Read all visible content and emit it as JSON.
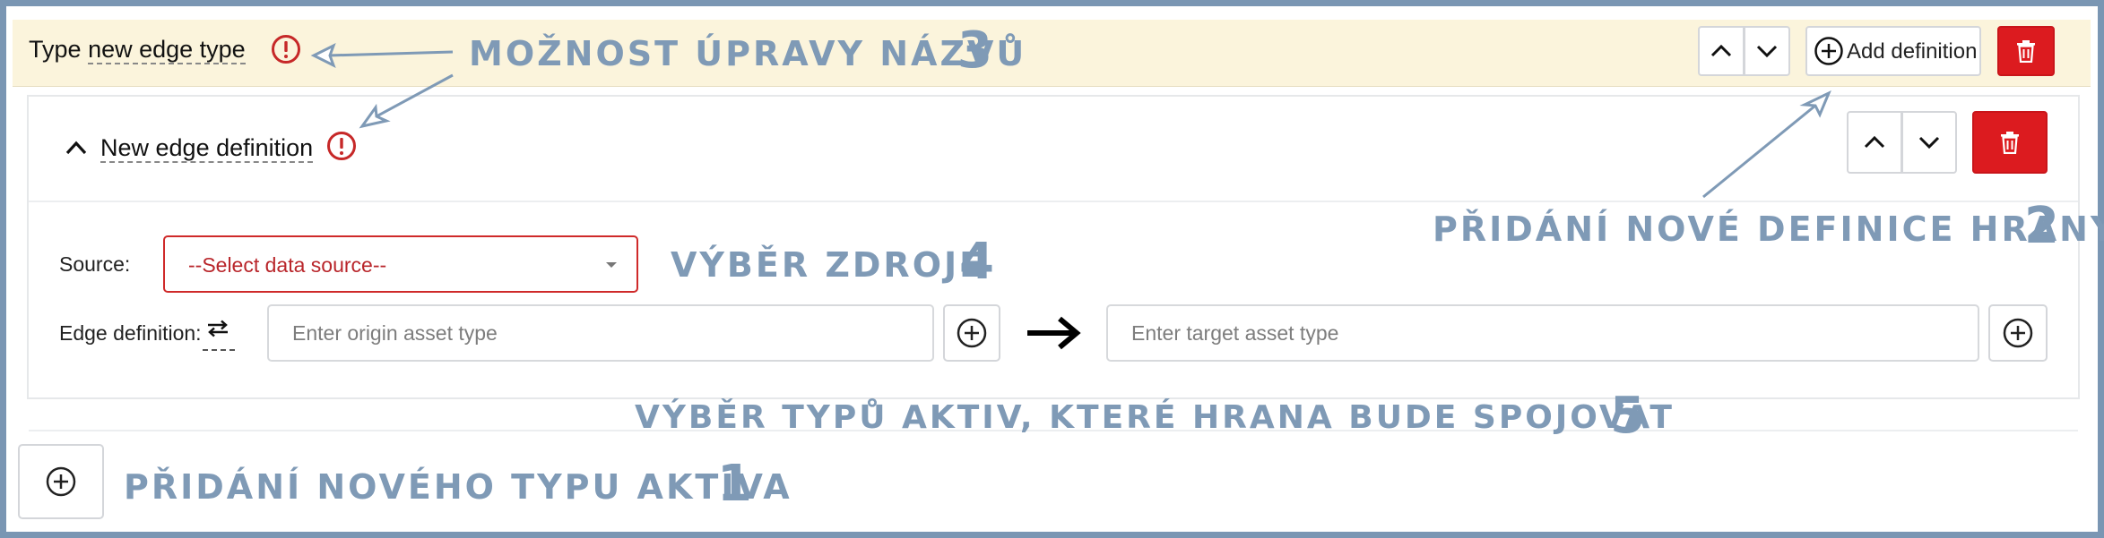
{
  "type_bar": {
    "prefix": "Type",
    "name": "new edge type",
    "add_definition_label": "Add definition"
  },
  "definition": {
    "title": "New edge definition",
    "source_label": "Source:",
    "source_select_value": "--Select data source--",
    "edge_definition_label": "Edge definition:",
    "origin_placeholder": "Enter origin asset type",
    "target_placeholder": "Enter target asset type"
  },
  "annotations": {
    "rename": {
      "text": "MOŽNOST ÚPRAVY NÁZVŮ",
      "number": "3"
    },
    "add_definition": {
      "text": "PŘIDÁNÍ NOVÉ DEFINICE HRANY",
      "number": "2"
    },
    "source": {
      "text": "VÝBĚR ZDROJE",
      "number": "4"
    },
    "asset_types": {
      "text": "VÝBĚR TYPŮ AKTIV, KTERÉ HRANA BUDE SPOJOVAT",
      "number": "5"
    },
    "add_type": {
      "text": "PŘIDÁNÍ NOVÉHO TYPU AKTIVA",
      "number": "1"
    }
  },
  "colors": {
    "frame": "#7a96b3",
    "annotation": "#7f9ab6",
    "danger": "#dc1b1f",
    "warning": "#c62828",
    "type_bar_bg": "#fbf4dc"
  },
  "icons": {
    "warning": "exclamation-circle-icon",
    "move_up": "chevron-up-icon",
    "move_down": "chevron-down-icon",
    "add": "plus-circle-icon",
    "delete": "trash-icon",
    "collapse": "chevron-up-icon",
    "swap": "swap-arrows-icon",
    "direction": "arrow-right-icon"
  }
}
